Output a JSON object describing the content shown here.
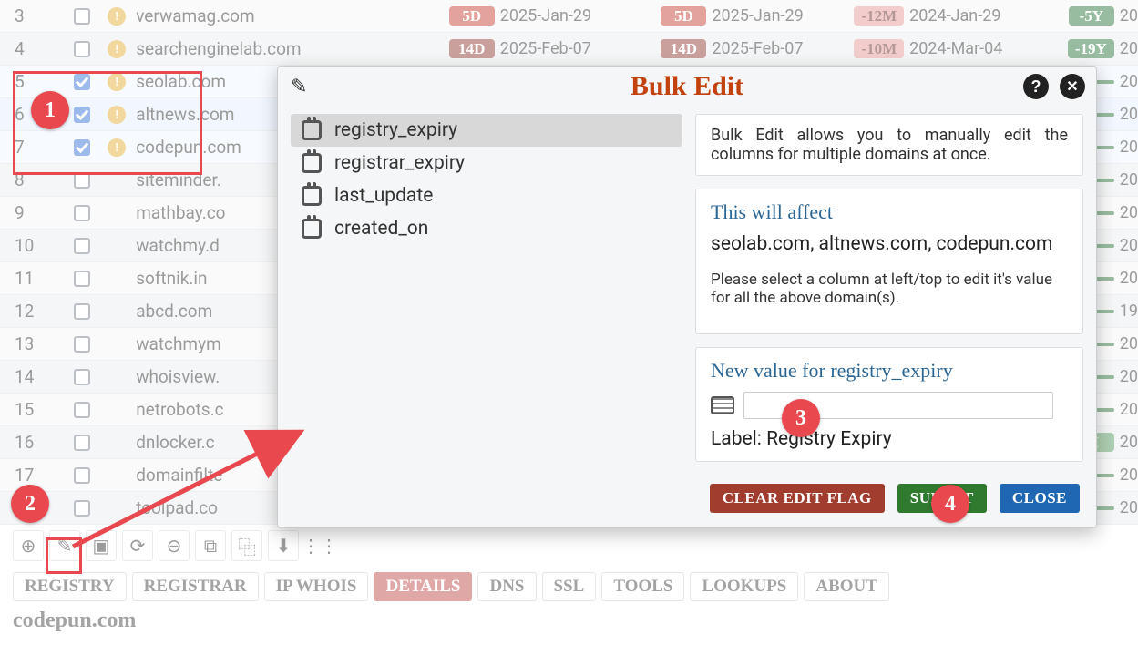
{
  "rows": [
    {
      "idx": 3,
      "checked": false,
      "warn": true,
      "domain": "verwamag.com",
      "b1": {
        "t": "5D",
        "cls": "red"
      },
      "d1": "2025-Jan-29",
      "b2": {
        "t": "5D",
        "cls": "red"
      },
      "d2": "2025-Jan-29",
      "b3": {
        "t": "-12M",
        "cls": "pink"
      },
      "d3": "2024-Jan-29",
      "b4": {
        "t": "-5Y",
        "cls": "grnd"
      },
      "d4": "20"
    },
    {
      "idx": 4,
      "checked": false,
      "warn": true,
      "domain": "searchenginelab.com",
      "b1": {
        "t": "14D",
        "cls": "maroon"
      },
      "d1": "2025-Feb-07",
      "b2": {
        "t": "14D",
        "cls": "maroon"
      },
      "d2": "2025-Feb-07",
      "b3": {
        "t": "-10M",
        "cls": "pink"
      },
      "d3": "2024-Mar-04",
      "b4": {
        "t": "-19Y",
        "cls": "grnd"
      },
      "d4": "20"
    },
    {
      "idx": 5,
      "checked": true,
      "warn": true,
      "domain": "seolab.com",
      "b4": {
        "t": "",
        "cls": "grnd"
      },
      "d4": "20"
    },
    {
      "idx": 6,
      "checked": true,
      "warn": true,
      "domain": "altnews.com",
      "b4": {
        "t": "",
        "cls": "grnd"
      },
      "d4": "20"
    },
    {
      "idx": 7,
      "checked": true,
      "warn": true,
      "domain": "codepun.com",
      "b4": {
        "t": "",
        "cls": "grnd"
      },
      "d4": "20"
    },
    {
      "idx": 8,
      "checked": false,
      "warn": false,
      "domain": "siteminder.",
      "b4": {
        "t": "",
        "cls": "grnd"
      },
      "d4": "20"
    },
    {
      "idx": 9,
      "checked": false,
      "warn": false,
      "domain": "mathbay.co",
      "b4": {
        "t": "",
        "cls": "grnd"
      },
      "d4": "20"
    },
    {
      "idx": 10,
      "checked": false,
      "warn": false,
      "domain": "watchmy.d",
      "b4": {
        "t": "",
        "cls": "grnd"
      },
      "d4": "20"
    },
    {
      "idx": 11,
      "checked": false,
      "warn": false,
      "domain": "softnik.in",
      "b4": {
        "t": "",
        "cls": "grnd"
      },
      "d4": "20"
    },
    {
      "idx": 12,
      "checked": false,
      "warn": false,
      "domain": "abcd.com",
      "b4": {
        "t": "",
        "cls": "grnd"
      },
      "d4": "19"
    },
    {
      "idx": 13,
      "checked": false,
      "warn": false,
      "domain": "watchmym",
      "b4": {
        "t": "",
        "cls": "grnd"
      },
      "d4": "20"
    },
    {
      "idx": 14,
      "checked": false,
      "warn": false,
      "domain": "whoisview.",
      "b4": {
        "t": "",
        "cls": "grnd"
      },
      "d4": "20"
    },
    {
      "idx": 15,
      "checked": false,
      "warn": false,
      "domain": "netrobots.c",
      "b4": {
        "t": "",
        "cls": "grnd"
      },
      "d4": "20"
    },
    {
      "idx": 16,
      "checked": false,
      "warn": false,
      "domain": "dnlocker.c",
      "b4": {
        "t": "M",
        "cls": "grnm"
      },
      "d4": "20"
    },
    {
      "idx": 17,
      "checked": false,
      "warn": false,
      "domain": "domainfilte",
      "b4": {
        "t": "",
        "cls": "grnd"
      },
      "d4": "20"
    },
    {
      "idx": 18,
      "checked": false,
      "warn": false,
      "domain": "toolpad.co",
      "b4": {
        "t": "",
        "cls": "grnd"
      },
      "d4": "20"
    }
  ],
  "toolbar_icons": [
    {
      "name": "add-icon",
      "g": "⊕"
    },
    {
      "name": "edit-icon",
      "g": "✎"
    },
    {
      "name": "delete-icon",
      "g": "▣"
    },
    {
      "name": "refresh-icon",
      "g": "⟳"
    },
    {
      "name": "block-icon",
      "g": "⊖"
    },
    {
      "name": "copy-icon",
      "g": "⧉"
    },
    {
      "name": "duplicate-icon",
      "g": "⿻"
    },
    {
      "name": "download-icon",
      "g": "⬇"
    },
    {
      "name": "settings-icon",
      "g": "⋮⋮"
    }
  ],
  "tabs": [
    {
      "label": "REGISTRY",
      "active": false
    },
    {
      "label": "REGISTRAR",
      "active": false
    },
    {
      "label": "IP WHOIS",
      "active": false
    },
    {
      "label": "DETAILS",
      "active": true
    },
    {
      "label": "DNS",
      "active": false
    },
    {
      "label": "SSL",
      "active": false
    },
    {
      "label": "TOOLS",
      "active": false
    },
    {
      "label": "LOOKUPS",
      "active": false
    },
    {
      "label": "ABOUT",
      "active": false
    }
  ],
  "page_title": "codepun.com",
  "dialog": {
    "title": "Bulk Edit",
    "columns": [
      {
        "k": "registry_expiry",
        "sel": true
      },
      {
        "k": "registrar_expiry",
        "sel": false
      },
      {
        "k": "last_update",
        "sel": false
      },
      {
        "k": "created_on",
        "sel": false
      }
    ],
    "intro": "Bulk Edit allows you to manually edit the columns for multiple domains at once.",
    "affect_h": "This will affect",
    "affect_list": "seolab.com, altnews.com, codepun.com",
    "affect_hint": "Please select a column at left/top to edit it's value for all the above domain(s).",
    "newval_h": "New value for registry_expiry",
    "newval_value": "",
    "newval_label_prefix": "Label: ",
    "newval_label": "Registry Expiry",
    "btn_clear": "CLEAR EDIT FLAG",
    "btn_submit": "SUBMIT",
    "btn_close": "CLOSE"
  },
  "annotations": [
    "1",
    "2",
    "3",
    "4"
  ]
}
